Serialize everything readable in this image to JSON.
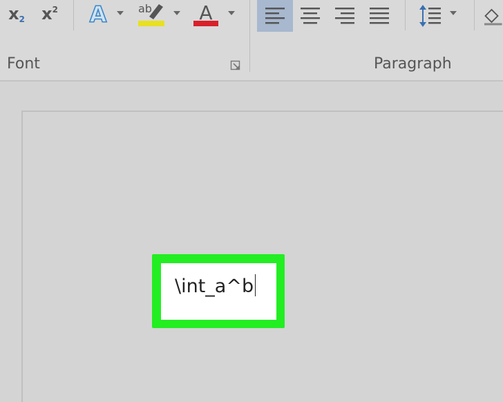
{
  "ribbon": {
    "font_group_label": "Font",
    "paragraph_group_label": "Paragraph",
    "subscript": {
      "base": "x",
      "script": "2"
    },
    "superscript": {
      "base": "x",
      "script": "2"
    },
    "text_effects_glyph": "A",
    "highlight_glyph": "ab",
    "font_color_glyph": "A",
    "colors": {
      "highlight": "#e8e020",
      "font_color": "#d8202a",
      "text_effects": "#3a86c8",
      "align_selected_bg": "#a7b8cf",
      "line_spacing_arrow": "#3a6fb0"
    }
  },
  "document": {
    "equation_input": "\\int_a^b",
    "highlight_color": "#22ee22"
  }
}
